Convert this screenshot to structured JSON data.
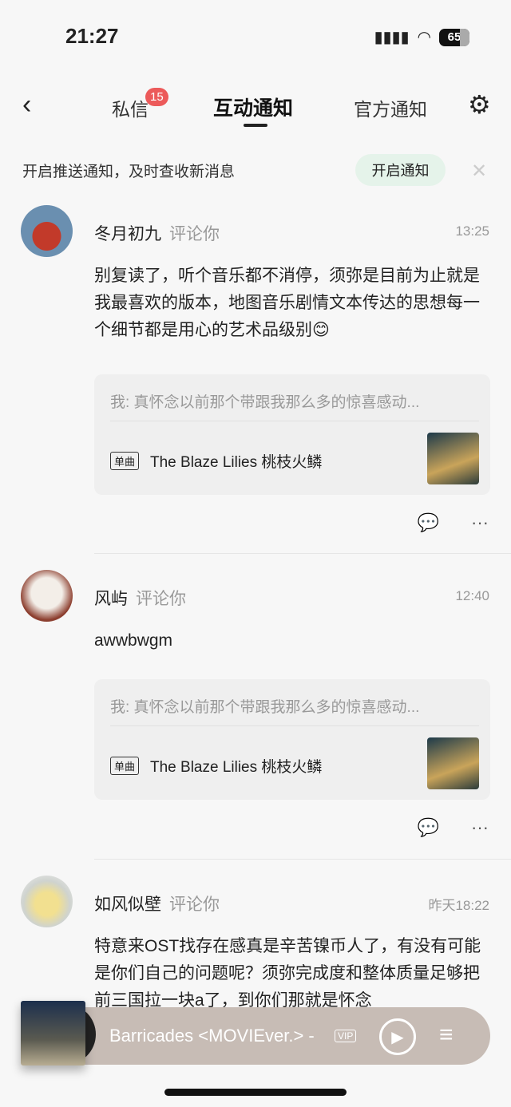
{
  "status": {
    "time": "21:27",
    "battery": "65"
  },
  "header": {
    "tabs": [
      {
        "label": "私信",
        "badge": "15"
      },
      {
        "label": "互动通知"
      },
      {
        "label": "官方通知"
      }
    ]
  },
  "notice": {
    "text": "开启推送通知，及时查收新消息",
    "button": "开启通知"
  },
  "items": [
    {
      "name": "冬月初九",
      "action": "评论你",
      "time": "13:25",
      "text": "别复读了，听个音乐都不消停，须弥是目前为止就是我最喜欢的版本，地图音乐剧情文本传达的思想每一个细节都是用心的艺术品级别😊",
      "quote": "我: 真怀念以前那个带跟我那么多的惊喜感动...",
      "tag": "单曲",
      "song": "The Blaze Lilies 桃枝火鳞"
    },
    {
      "name": "风屿",
      "action": "评论你",
      "time": "12:40",
      "text": "awwbwgm",
      "quote": "我: 真怀念以前那个带跟我那么多的惊喜感动...",
      "tag": "单曲",
      "song": "The Blaze Lilies 桃枝火鳞"
    },
    {
      "name": "如风似壁",
      "action": "评论你",
      "time": "昨天18:22",
      "text": "特意来OST找存在感真是辛苦镍币人了，有没有可能是你们自己的问题呢？须弥完成度和整体质量足够把前三国拉一块a了，到你们那就是怀念"
    }
  ],
  "player": {
    "title": "Barricades <MOVIEver.> -",
    "vip": "VIP"
  }
}
